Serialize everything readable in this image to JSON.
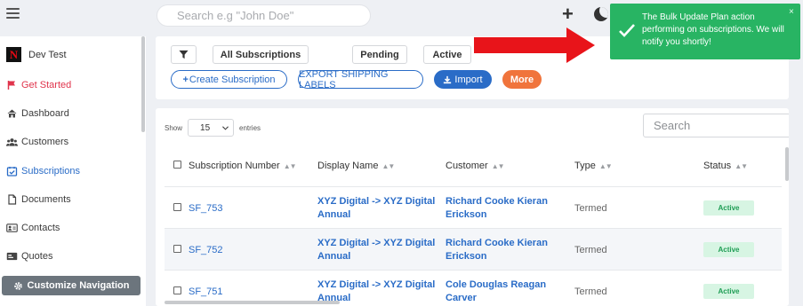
{
  "topbar": {
    "search_placeholder": "Search e.g \"John Doe\""
  },
  "sidebar": {
    "org_name": "Dev Test",
    "items": [
      {
        "label": "Get Started",
        "icon": "flag-icon"
      },
      {
        "label": "Dashboard",
        "icon": "home-icon"
      },
      {
        "label": "Customers",
        "icon": "users-icon"
      },
      {
        "label": "Subscriptions",
        "icon": "calendar-check-icon"
      },
      {
        "label": "Documents",
        "icon": "document-icon"
      },
      {
        "label": "Contacts",
        "icon": "contact-card-icon"
      },
      {
        "label": "Quotes",
        "icon": "quote-card-icon"
      }
    ],
    "customize_label": "Customize Navigation"
  },
  "toolbar": {
    "filter_icon": "filter-icon",
    "all_subscriptions": "All Subscriptions",
    "pending": "Pending",
    "active": "Active",
    "create_subscription": "Create Subscription",
    "export_shipping_labels": "EXPORT SHIPPING LABELS",
    "import": "Import",
    "more": "More"
  },
  "toast": {
    "message": "The Bulk Update Plan action performing on subscriptions. We will notify you shortly!",
    "close": "×",
    "color": "#28b463"
  },
  "table": {
    "show_label": "Show",
    "entries_value": "15",
    "entries_label": "entries",
    "search_placeholder": "Search",
    "headers": [
      "Subscription Number",
      "Display Name",
      "Customer",
      "Type",
      "Status"
    ],
    "rows": [
      {
        "number": "SF_753",
        "display_line1": "XYZ Digital -> XYZ Digital",
        "display_line2": "Annual",
        "customer_line1": "Richard Cooke Kieran",
        "customer_line2": "Erickson",
        "type": "Termed",
        "status": "Active"
      },
      {
        "number": "SF_752",
        "display_line1": "XYZ Digital -> XYZ Digital",
        "display_line2": "Annual",
        "customer_line1": "Richard Cooke Kieran",
        "customer_line2": "Erickson",
        "type": "Termed",
        "status": "Active"
      },
      {
        "number": "SF_751",
        "display_line1": "XYZ Digital -> XYZ Digital",
        "display_line2": "Annual",
        "customer_line1": "Cole Douglas Reagan",
        "customer_line2": "Carver",
        "type": "Termed",
        "status": "Active"
      }
    ]
  },
  "colors": {
    "accent": "#2a6cc7",
    "danger": "#e0344c",
    "orange": "#f0743c",
    "success": "#28b463",
    "arrow": "#e8141a"
  }
}
